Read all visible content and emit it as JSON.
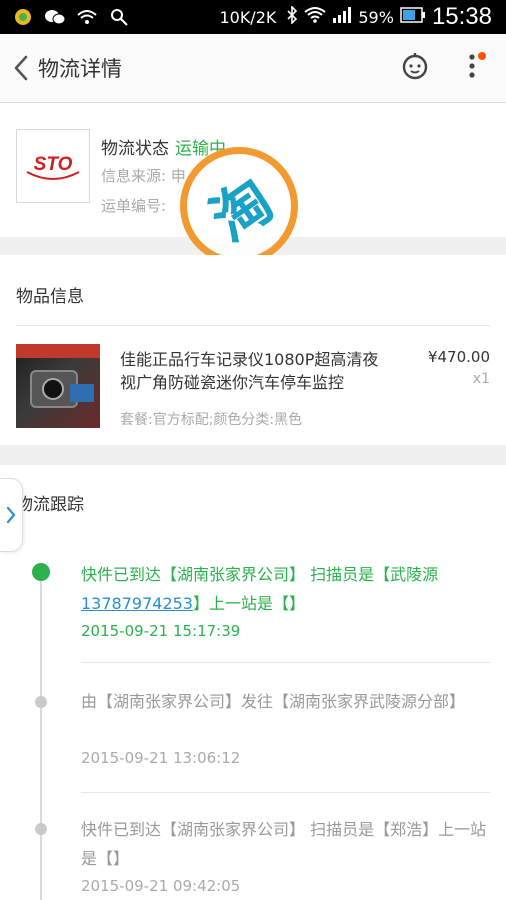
{
  "status_bar": {
    "speed": "10K/2K",
    "battery": "59%",
    "time": "15:38",
    "icons": [
      "app-icon",
      "wechat-icon",
      "wifi-hotspot-icon",
      "clean-icon",
      "bluetooth-icon",
      "wifi-icon",
      "signal-icon",
      "battery-icon"
    ]
  },
  "header": {
    "title": "物流详情",
    "icons": [
      "back-arrow-icon",
      "customer-service-icon",
      "more-icon"
    ],
    "accent": "#ff5000"
  },
  "status_card": {
    "logo_text": "STO",
    "status_label": "物流状态",
    "status_value": "运输中",
    "source_label": "信息来源: 申",
    "tracking_label": "运单编号: "
  },
  "stamp_text": "淘",
  "goods": {
    "section_title": "物品信息",
    "name": "佳能正品行车记录仪1080P超高清夜视广角防碰瓷迷你汽车停车监控",
    "price": "¥470.00",
    "qty": "x1",
    "spec": "套餐:官方标配;颜色分类:黑色"
  },
  "tracking": {
    "section_title": "物流跟踪",
    "events": [
      {
        "text_a": "快件已到达【湖南张家界公司】 扫描员是【武陵源",
        "phone": "13787974253",
        "text_b": "】上一站是【】",
        "time": "2015-09-21 15:17:39"
      },
      {
        "text": "由【湖南张家界公司】发往【湖南张家界武陵源分部】",
        "time": "2015-09-21 13:06:12"
      },
      {
        "text": "快件已到达【湖南张家界公司】 扫描员是【郑浩】上一站是【】",
        "time": "2015-09-21 09:42:05"
      }
    ]
  },
  "colors": {
    "green": "#2bb24c",
    "stamp_ring": "#f29a2f",
    "stamp_text": "#1aa1c6",
    "logo_red": "#d01e1e"
  }
}
